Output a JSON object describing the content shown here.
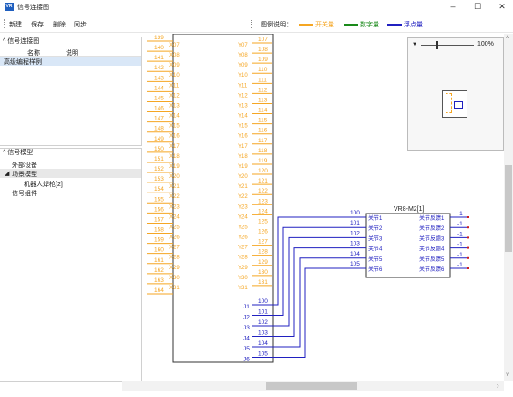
{
  "window": {
    "title": "信号连接图",
    "app_icon": "VR"
  },
  "toolbar": {
    "new": "新建",
    "save": "保存",
    "delete": "删除",
    "sync": "同步"
  },
  "legend": {
    "label": "图例说明：",
    "items": [
      {
        "text": "开关量",
        "color": "#f5a623"
      },
      {
        "text": "数字量",
        "color": "#1a8a1a"
      },
      {
        "text": "浮点量",
        "color": "#2020c0"
      }
    ]
  },
  "connection_panel": {
    "title": "信号连接图",
    "columns": [
      "名称",
      "说明"
    ],
    "rows": [
      {
        "name": "高级编程样例",
        "desc": ""
      }
    ]
  },
  "model_panel": {
    "title": "信号模型",
    "items": [
      {
        "label": "外部设备",
        "level": 1
      },
      {
        "label": "场景模型",
        "level": 1,
        "expanded": true
      },
      {
        "label": "机器人焊枪[2]",
        "level": 2
      },
      {
        "label": "信号组件",
        "level": 0
      }
    ]
  },
  "navigator": {
    "zoom": "100%"
  },
  "signal_block": {
    "left_numbers": [
      "139",
      "140",
      "141",
      "142",
      "143",
      "144",
      "145",
      "146",
      "147",
      "148",
      "149",
      "150",
      "151",
      "152",
      "153",
      "154",
      "155",
      "156",
      "157",
      "158",
      "159",
      "160",
      "161",
      "162",
      "163",
      "164"
    ],
    "left_labels": [
      "X07",
      "X08",
      "X09",
      "X10",
      "X11",
      "X12",
      "X13",
      "X14",
      "X15",
      "X16",
      "X17",
      "X18",
      "X19",
      "X20",
      "X21",
      "X22",
      "X23",
      "X24",
      "X25",
      "X26",
      "X27",
      "X28",
      "X29",
      "X30",
      "X31"
    ],
    "right_labels": [
      "Y07",
      "Y08",
      "Y09",
      "Y10",
      "Y11",
      "Y12",
      "Y13",
      "Y14",
      "Y15",
      "Y16",
      "Y17",
      "Y18",
      "Y19",
      "Y20",
      "Y21",
      "Y22",
      "Y23",
      "Y24",
      "Y25",
      "Y26",
      "Y27",
      "Y28",
      "Y29",
      "Y30",
      "Y31"
    ],
    "right_numbers": [
      "107",
      "108",
      "109",
      "110",
      "111",
      "112",
      "113",
      "114",
      "115",
      "116",
      "117",
      "118",
      "119",
      "120",
      "121",
      "122",
      "123",
      "124",
      "125",
      "126",
      "127",
      "128",
      "129",
      "130",
      "131"
    ],
    "j_labels": [
      "J1",
      "J2",
      "J3",
      "J4",
      "J5",
      "J6"
    ],
    "j_numbers": [
      "100",
      "101",
      "102",
      "103",
      "104",
      "105"
    ]
  },
  "vr_block": {
    "title": "VR8-M2[1]",
    "inputs": [
      "关节1",
      "关节2",
      "关节3",
      "关节4",
      "关节5",
      "关节6"
    ],
    "input_numbers": [
      "100",
      "101",
      "102",
      "103",
      "104",
      "105"
    ],
    "outputs": [
      "关节反馈1",
      "关节反馈2",
      "关节反馈3",
      "关节反馈4",
      "关节反馈5",
      "关节反馈6"
    ],
    "output_values": [
      "-1",
      "-1",
      "-1",
      "-1",
      "-1",
      "-1"
    ]
  }
}
